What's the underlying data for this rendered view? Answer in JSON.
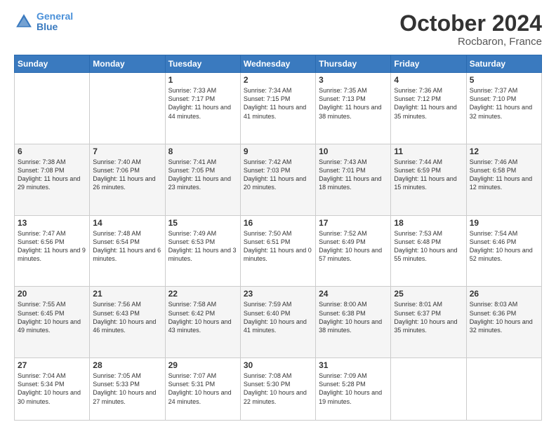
{
  "header": {
    "logo_line1": "General",
    "logo_line2": "Blue",
    "month": "October 2024",
    "location": "Rocbaron, France"
  },
  "days_of_week": [
    "Sunday",
    "Monday",
    "Tuesday",
    "Wednesday",
    "Thursday",
    "Friday",
    "Saturday"
  ],
  "weeks": [
    [
      {
        "day": "",
        "text": ""
      },
      {
        "day": "",
        "text": ""
      },
      {
        "day": "1",
        "text": "Sunrise: 7:33 AM\nSunset: 7:17 PM\nDaylight: 11 hours and 44 minutes."
      },
      {
        "day": "2",
        "text": "Sunrise: 7:34 AM\nSunset: 7:15 PM\nDaylight: 11 hours and 41 minutes."
      },
      {
        "day": "3",
        "text": "Sunrise: 7:35 AM\nSunset: 7:13 PM\nDaylight: 11 hours and 38 minutes."
      },
      {
        "day": "4",
        "text": "Sunrise: 7:36 AM\nSunset: 7:12 PM\nDaylight: 11 hours and 35 minutes."
      },
      {
        "day": "5",
        "text": "Sunrise: 7:37 AM\nSunset: 7:10 PM\nDaylight: 11 hours and 32 minutes."
      }
    ],
    [
      {
        "day": "6",
        "text": "Sunrise: 7:38 AM\nSunset: 7:08 PM\nDaylight: 11 hours and 29 minutes."
      },
      {
        "day": "7",
        "text": "Sunrise: 7:40 AM\nSunset: 7:06 PM\nDaylight: 11 hours and 26 minutes."
      },
      {
        "day": "8",
        "text": "Sunrise: 7:41 AM\nSunset: 7:05 PM\nDaylight: 11 hours and 23 minutes."
      },
      {
        "day": "9",
        "text": "Sunrise: 7:42 AM\nSunset: 7:03 PM\nDaylight: 11 hours and 20 minutes."
      },
      {
        "day": "10",
        "text": "Sunrise: 7:43 AM\nSunset: 7:01 PM\nDaylight: 11 hours and 18 minutes."
      },
      {
        "day": "11",
        "text": "Sunrise: 7:44 AM\nSunset: 6:59 PM\nDaylight: 11 hours and 15 minutes."
      },
      {
        "day": "12",
        "text": "Sunrise: 7:46 AM\nSunset: 6:58 PM\nDaylight: 11 hours and 12 minutes."
      }
    ],
    [
      {
        "day": "13",
        "text": "Sunrise: 7:47 AM\nSunset: 6:56 PM\nDaylight: 11 hours and 9 minutes."
      },
      {
        "day": "14",
        "text": "Sunrise: 7:48 AM\nSunset: 6:54 PM\nDaylight: 11 hours and 6 minutes."
      },
      {
        "day": "15",
        "text": "Sunrise: 7:49 AM\nSunset: 6:53 PM\nDaylight: 11 hours and 3 minutes."
      },
      {
        "day": "16",
        "text": "Sunrise: 7:50 AM\nSunset: 6:51 PM\nDaylight: 11 hours and 0 minutes."
      },
      {
        "day": "17",
        "text": "Sunrise: 7:52 AM\nSunset: 6:49 PM\nDaylight: 10 hours and 57 minutes."
      },
      {
        "day": "18",
        "text": "Sunrise: 7:53 AM\nSunset: 6:48 PM\nDaylight: 10 hours and 55 minutes."
      },
      {
        "day": "19",
        "text": "Sunrise: 7:54 AM\nSunset: 6:46 PM\nDaylight: 10 hours and 52 minutes."
      }
    ],
    [
      {
        "day": "20",
        "text": "Sunrise: 7:55 AM\nSunset: 6:45 PM\nDaylight: 10 hours and 49 minutes."
      },
      {
        "day": "21",
        "text": "Sunrise: 7:56 AM\nSunset: 6:43 PM\nDaylight: 10 hours and 46 minutes."
      },
      {
        "day": "22",
        "text": "Sunrise: 7:58 AM\nSunset: 6:42 PM\nDaylight: 10 hours and 43 minutes."
      },
      {
        "day": "23",
        "text": "Sunrise: 7:59 AM\nSunset: 6:40 PM\nDaylight: 10 hours and 41 minutes."
      },
      {
        "day": "24",
        "text": "Sunrise: 8:00 AM\nSunset: 6:38 PM\nDaylight: 10 hours and 38 minutes."
      },
      {
        "day": "25",
        "text": "Sunrise: 8:01 AM\nSunset: 6:37 PM\nDaylight: 10 hours and 35 minutes."
      },
      {
        "day": "26",
        "text": "Sunrise: 8:03 AM\nSunset: 6:36 PM\nDaylight: 10 hours and 32 minutes."
      }
    ],
    [
      {
        "day": "27",
        "text": "Sunrise: 7:04 AM\nSunset: 5:34 PM\nDaylight: 10 hours and 30 minutes."
      },
      {
        "day": "28",
        "text": "Sunrise: 7:05 AM\nSunset: 5:33 PM\nDaylight: 10 hours and 27 minutes."
      },
      {
        "day": "29",
        "text": "Sunrise: 7:07 AM\nSunset: 5:31 PM\nDaylight: 10 hours and 24 minutes."
      },
      {
        "day": "30",
        "text": "Sunrise: 7:08 AM\nSunset: 5:30 PM\nDaylight: 10 hours and 22 minutes."
      },
      {
        "day": "31",
        "text": "Sunrise: 7:09 AM\nSunset: 5:28 PM\nDaylight: 10 hours and 19 minutes."
      },
      {
        "day": "",
        "text": ""
      },
      {
        "day": "",
        "text": ""
      }
    ]
  ]
}
